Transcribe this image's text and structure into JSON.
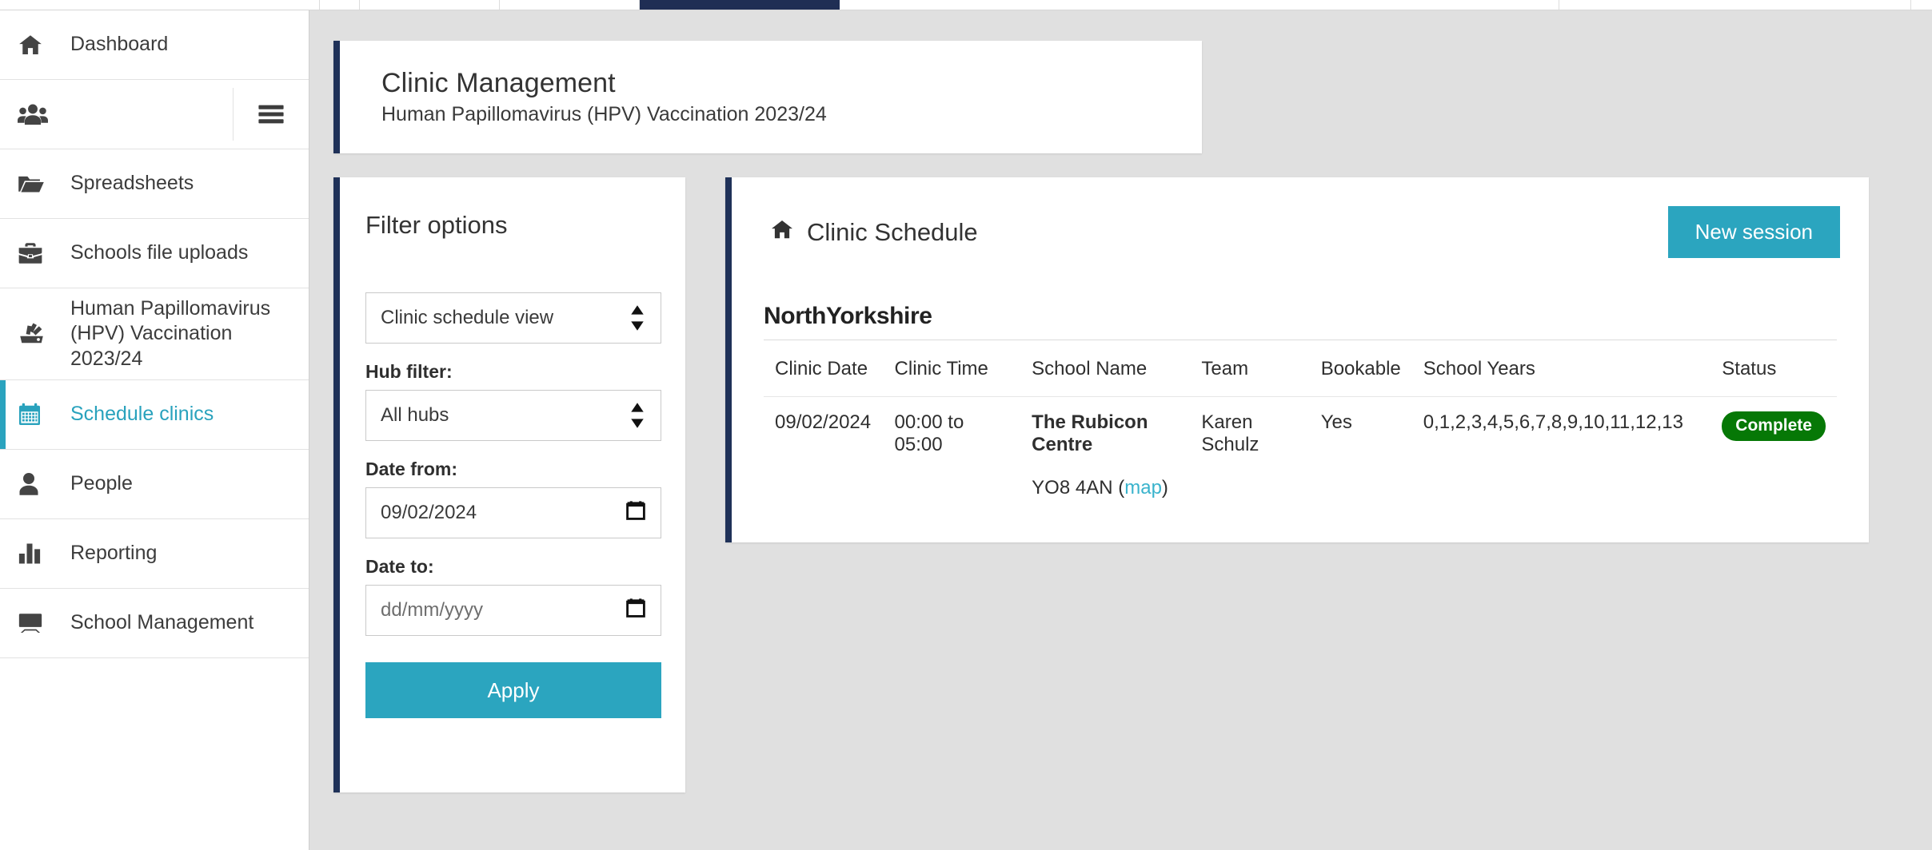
{
  "topnav": {
    "items": [
      {
        "name": "nav-segment-1",
        "active": false
      },
      {
        "name": "nav-segment-2",
        "active": false
      },
      {
        "name": "nav-segment-3",
        "active": false
      },
      {
        "name": "nav-segment-active",
        "active": true
      },
      {
        "name": "nav-segment-5",
        "active": false
      },
      {
        "name": "nav-segment-6",
        "active": false
      }
    ],
    "active_color": "#1f2e54"
  },
  "sidebar": {
    "items": [
      {
        "label": "Dashboard",
        "icon": "home-icon",
        "active": false
      },
      {
        "label": "",
        "icon": "people-group-icon",
        "active": false,
        "has_hamburger": true,
        "hamburger_icon": "hamburger-menu-icon"
      },
      {
        "label": "Spreadsheets",
        "icon": "folder-open-icon",
        "active": false
      },
      {
        "label": "Schools file uploads",
        "icon": "briefcase-icon",
        "active": false
      },
      {
        "label": "Human Papillomavirus (HPV) Vaccination 2023/24",
        "icon": "fan-vaccination-icon",
        "active": false
      },
      {
        "label": "Schedule clinics",
        "icon": "calendar-icon",
        "active": true
      },
      {
        "label": "People",
        "icon": "person-icon",
        "active": false
      },
      {
        "label": "Reporting",
        "icon": "bar-chart-icon",
        "active": false
      },
      {
        "label": "School Management",
        "icon": "desktop-icon",
        "active": false
      }
    ],
    "active_color": "#29a2bd"
  },
  "header": {
    "title": "Clinic Management",
    "subtitle": "Human Papillomavirus (HPV) Vaccination 2023/24",
    "accent_color": "#1f3158"
  },
  "filter": {
    "title": "Filter options",
    "view_select": {
      "value": "Clinic schedule view",
      "icon": "sort-updown-icon"
    },
    "hub_label": "Hub filter:",
    "hub_select": {
      "value": "All hubs",
      "icon": "sort-updown-icon"
    },
    "date_from_label": "Date from:",
    "date_from_value": "09/02/2024",
    "date_to_label": "Date to:",
    "date_to_placeholder": "dd/mm/yyyy",
    "date_icon": "calendar-picker-icon",
    "apply_label": "Apply",
    "button_color": "#2ba5bf"
  },
  "schedule": {
    "title": "Clinic Schedule",
    "title_icon": "home-icon",
    "new_session_label": "New session",
    "region": "NorthYorkshire",
    "columns": [
      "Clinic Date",
      "Clinic Time",
      "School Name",
      "Team",
      "Bookable",
      "School Years",
      "Status"
    ],
    "rows": [
      {
        "clinic_date": "09/02/2024",
        "clinic_time": "00:00 to 05:00",
        "school_name": "The Rubicon Centre",
        "team": "Karen Schulz",
        "bookable": "Yes",
        "school_years": "0,1,2,3,4,5,6,7,8,9,10,11,12,13",
        "status": "Complete",
        "status_color": "#067806",
        "postcode": "YO8 4AN",
        "map_label": "map",
        "map_paren_open": "(",
        "map_paren_close": ")"
      }
    ]
  }
}
